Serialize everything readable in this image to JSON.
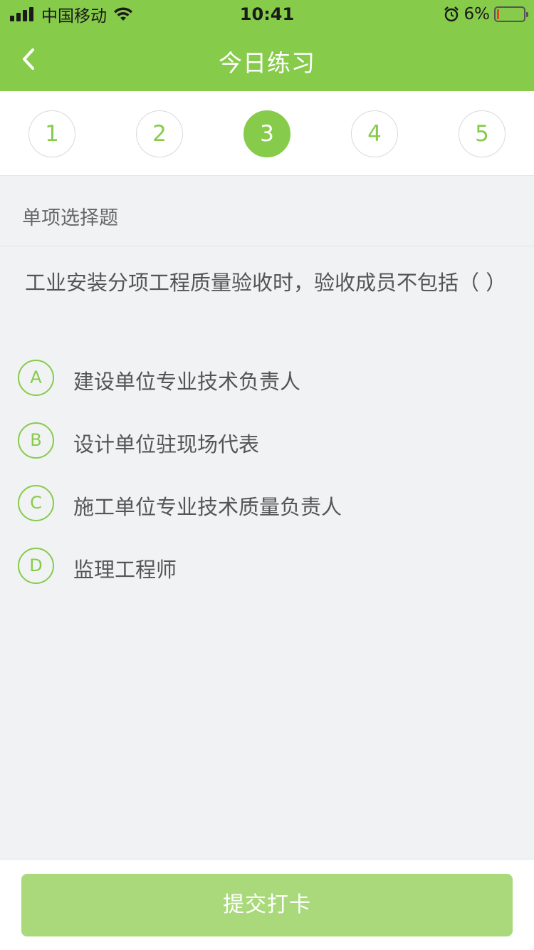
{
  "status_bar": {
    "carrier": "中国移动",
    "time": "10:41",
    "battery_pct": "6%",
    "icons": [
      "signal-icon",
      "wifi-icon",
      "alarm-icon",
      "battery-icon"
    ],
    "battery_level": 0.06
  },
  "nav": {
    "title": "今日练习",
    "back_icon": "chevron-left-icon"
  },
  "stepper": {
    "steps": [
      "1",
      "2",
      "3",
      "4",
      "5"
    ],
    "active_index": 2
  },
  "question": {
    "type": "单项选择题",
    "text": "工业安装分项工程质量验收时，验收成员不包括（    ）",
    "options": [
      {
        "letter": "A",
        "text": "建设单位专业技术负责人"
      },
      {
        "letter": "B",
        "text": "设计单位驻现场代表"
      },
      {
        "letter": "C",
        "text": "施工单位专业技术质量负责人"
      },
      {
        "letter": "D",
        "text": "监理工程师"
      }
    ]
  },
  "footer": {
    "submit_label": "提交打卡"
  },
  "colors": {
    "primary": "#87cb4a",
    "primary_disabled": "#a9d97b",
    "background": "#f1f2f4",
    "battery_low": "#e0462b"
  }
}
